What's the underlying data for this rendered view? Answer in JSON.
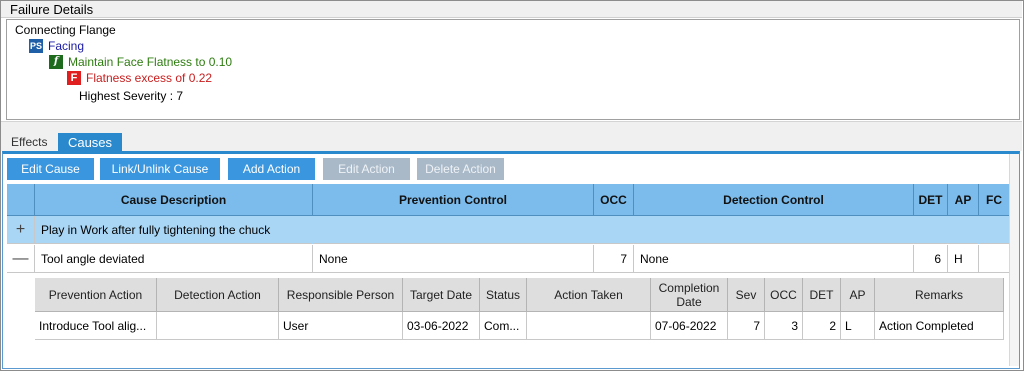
{
  "failure_details": {
    "title": "Failure Details",
    "tree": {
      "root": "Connecting Flange",
      "function_group": {
        "icon": "PS",
        "label": "Facing"
      },
      "function": {
        "icon": "f",
        "label": "Maintain Face Flatness to 0.10"
      },
      "failure": {
        "icon": "F",
        "label": "Flatness excess of 0.22"
      },
      "severity": "Highest Severity : 7"
    }
  },
  "tabs": [
    {
      "label": "Effects",
      "active": false
    },
    {
      "label": "Causes",
      "active": true
    }
  ],
  "toolbar": {
    "edit_cause": "Edit Cause",
    "link_unlink_cause": "Link/Unlink Cause",
    "add_action": "Add Action",
    "edit_action": "Edit Action",
    "delete_action": "Delete Action"
  },
  "causes_grid": {
    "columns": [
      "Cause Description",
      "Prevention Control",
      "OCC",
      "Detection Control",
      "DET",
      "AP",
      "FC"
    ],
    "rows": [
      {
        "expander": "+",
        "cause": "Play in Work after fully tightening the chuck",
        "prevention": "",
        "occ": "",
        "detection": "",
        "det": "",
        "ap": "",
        "fc": ""
      },
      {
        "expander": "—",
        "cause": "Tool angle deviated",
        "prevention": "None",
        "occ": "7",
        "detection": "None",
        "det": "6",
        "ap": "H",
        "fc": ""
      }
    ]
  },
  "actions_grid": {
    "columns": [
      "Prevention Action",
      "Detection Action",
      "Responsible Person",
      "Target Date",
      "Status",
      "Action Taken",
      "Completion Date",
      "Sev",
      "OCC",
      "DET",
      "AP",
      "Remarks"
    ],
    "rows": [
      {
        "prevention_action": "Introduce Tool alig...",
        "detection_action": "",
        "responsible": "User",
        "target_date": "03-06-2022",
        "status": "Com...",
        "action_taken": "",
        "completion_date": "07-06-2022",
        "sev": "7",
        "occ": "3",
        "det": "2",
        "ap": "L",
        "remarks": "Action Completed"
      }
    ]
  },
  "colors": {
    "accent": "#2a89cc",
    "header_blue": "#7bbcec",
    "selected_row": "#a9d6f5",
    "function_group": "#1a1aa6",
    "function": "#2e7d10",
    "failure": "#c81e1e"
  }
}
